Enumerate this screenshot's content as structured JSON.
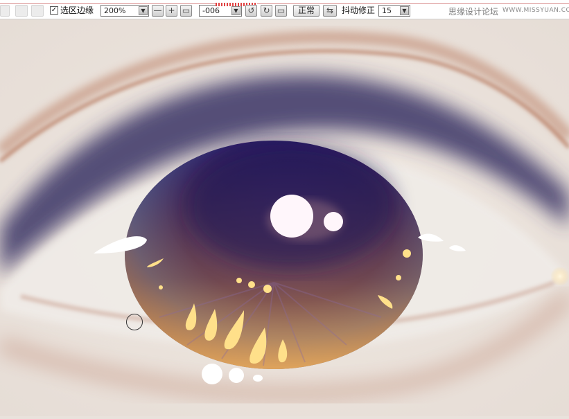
{
  "toolbar": {
    "selection_edge_label": "选区边缘",
    "selection_edge_checked": true,
    "zoom_value": "200%",
    "rotation_value": "-006",
    "mode_label": "正常",
    "stabilizer_label": "抖动修正",
    "stabilizer_value": "15"
  },
  "watermark": {
    "text": "思缘设计论坛",
    "url": "WWW.MISSYUAN.COM"
  },
  "colors": {
    "iris": "#2a1b63",
    "skin": "#ece4dd",
    "lash": "#b06c4f",
    "highlight": "#ffe08a"
  }
}
